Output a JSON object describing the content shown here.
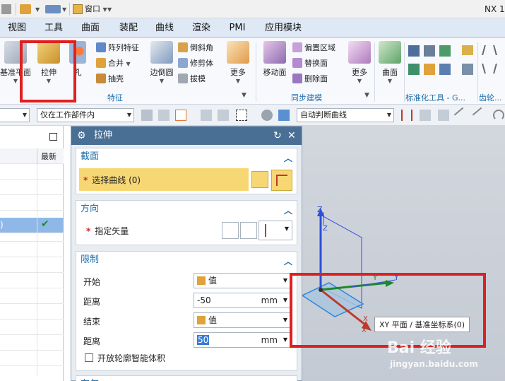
{
  "titlebar": {
    "window_menu": "窗口",
    "app_title": "NX 1"
  },
  "menu": {
    "tabs": [
      "视图",
      "工具",
      "曲面",
      "装配",
      "曲线",
      "渲染",
      "PMI",
      "应用模块"
    ]
  },
  "ribbon": {
    "datum_plane": "基准平面",
    "extrude": "拉伸",
    "hole": "孔",
    "pattern_feature": "阵列特征",
    "unite": "合并",
    "shell": "抽壳",
    "edge_blend": "边倒圆",
    "chamfer": "倒斜角",
    "trim_body": "修剪体",
    "draft": "拔模",
    "more1": "更多",
    "feature_group": "特征",
    "move_face": "移动面",
    "offset_region": "偏置区域",
    "replace_face": "替换面",
    "delete_face": "删除面",
    "more2": "更多",
    "sync_group": "同步建模",
    "surface": "曲面",
    "std_tools_group": "标准化工具 - G...",
    "gear_group": "齿轮..."
  },
  "filterbar": {
    "scope": "仅在工作部件内",
    "curve_rule": "自动判断曲线"
  },
  "navigator": {
    "col_latest": "最新",
    "row_partial": ")"
  },
  "dialog": {
    "title": "拉伸",
    "section_profile": "截面",
    "select_curve": "选择曲线 (0)",
    "section_direction": "方向",
    "specify_vector": "指定矢量",
    "section_limits": "限制",
    "start_label": "开始",
    "start_value": "值",
    "dist1_label": "距离",
    "dist1_value": "-50",
    "dist1_unit": "mm",
    "end_label": "结束",
    "end_value": "值",
    "dist2_label": "距离",
    "dist2_value": "50",
    "dist2_unit": "mm",
    "open_profile": "开放轮廓智能体积",
    "section_boolean": "布尔"
  },
  "graphics": {
    "axis_z1": "Z",
    "axis_z2": "Z",
    "axis_y1": "Y",
    "axis_y2": "Y",
    "axis_x1": "X",
    "axis_x2": "X",
    "tooltip": "XY 平面 / 基准坐标系(0)"
  },
  "watermark": {
    "brand": "Bai  经验",
    "url": "jingyan.baidu.com"
  },
  "colors": {
    "accent": "#1f6fae",
    "dialog_title": "#4a6f95",
    "highlight_field": "#f7d774",
    "annotation_red": "#e02020"
  }
}
